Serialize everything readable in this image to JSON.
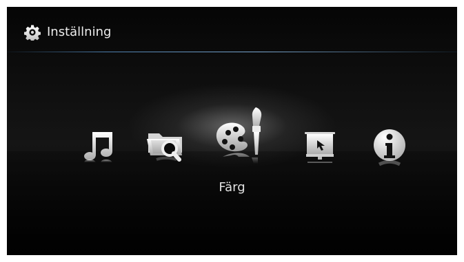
{
  "window": {
    "title": "Inställning"
  },
  "settings_menu": {
    "selected_label": "Färg",
    "items": [
      {
        "icon": "music-icon"
      },
      {
        "icon": "folder-search-icon"
      },
      {
        "icon": "palette-brush-icon",
        "selected": true
      },
      {
        "icon": "presentation-screen-icon"
      },
      {
        "icon": "info-icon"
      }
    ]
  },
  "colors": {
    "background": "#0b0b0b",
    "accent_rule": "#5f93c4",
    "icon": "#e6e6e6"
  }
}
